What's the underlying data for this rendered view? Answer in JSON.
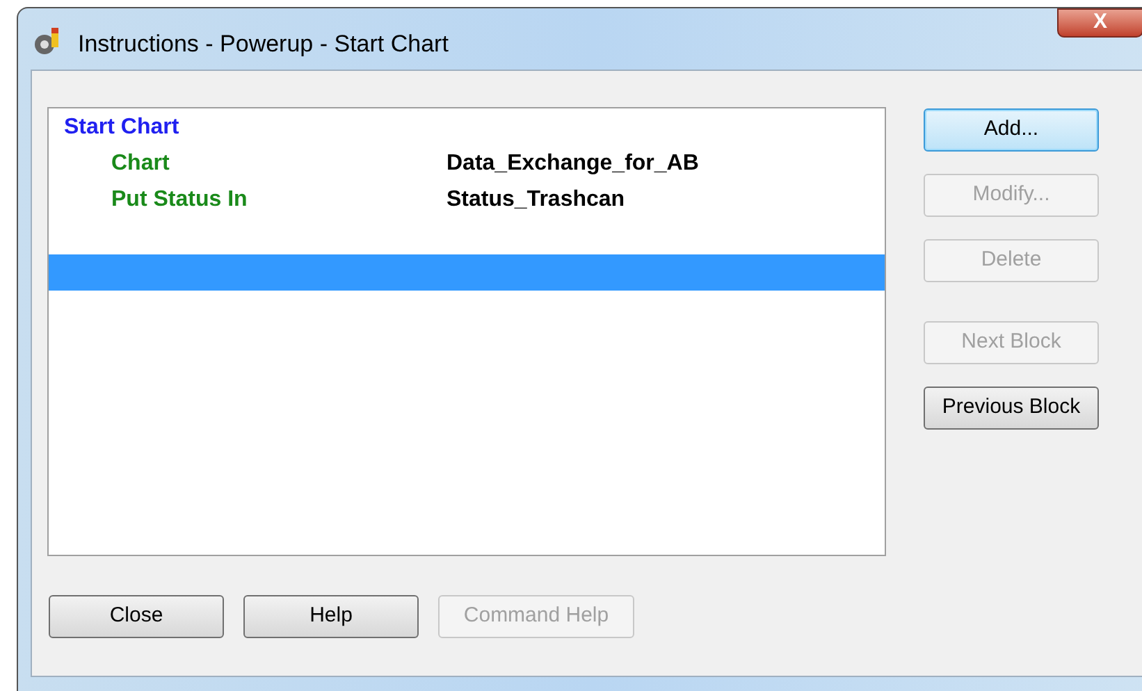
{
  "window": {
    "title": "Instructions - Powerup - Start Chart",
    "close_glyph": "X"
  },
  "list": {
    "rows": [
      {
        "kind": "header",
        "label": "Start Chart",
        "selected": false
      },
      {
        "kind": "property",
        "label": "Chart",
        "value": "Data_Exchange_for_AB",
        "selected": false
      },
      {
        "kind": "property",
        "label": "Put Status In",
        "value": "Status_Trashcan",
        "selected": false
      },
      {
        "kind": "blank",
        "selected": false
      },
      {
        "kind": "blank",
        "selected": true
      }
    ]
  },
  "side_buttons": [
    {
      "label": "Add...",
      "disabled": false,
      "focused": true
    },
    {
      "label": "Modify...",
      "disabled": true,
      "focused": false
    },
    {
      "label": "Delete",
      "disabled": true,
      "focused": false
    },
    {
      "label": "Next Block",
      "disabled": true,
      "focused": false
    },
    {
      "label": "Previous Block",
      "disabled": false,
      "focused": false
    }
  ],
  "bottom_buttons": [
    {
      "label": "Close",
      "disabled": false
    },
    {
      "label": "Help",
      "disabled": false
    },
    {
      "label": "Command Help",
      "disabled": true
    }
  ]
}
